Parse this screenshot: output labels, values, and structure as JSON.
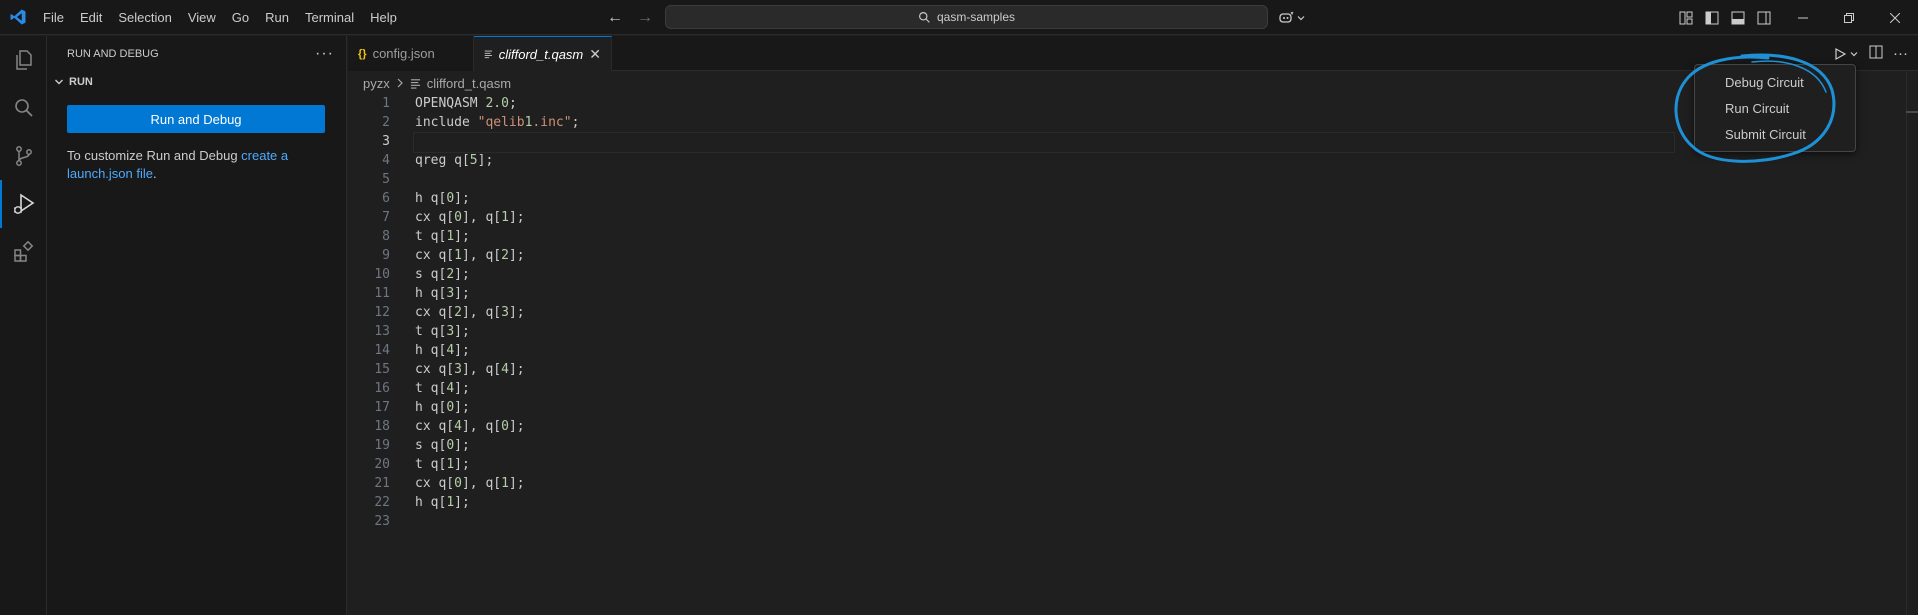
{
  "menu": [
    "File",
    "Edit",
    "Selection",
    "View",
    "Go",
    "Run",
    "Terminal",
    "Help"
  ],
  "search": {
    "text": "qasm-samples"
  },
  "activity": [
    "explorer-icon",
    "search-icon",
    "source-control-icon",
    "run-debug-icon",
    "extensions-icon"
  ],
  "sidebar": {
    "title": "RUN AND DEBUG",
    "section": "RUN",
    "run_button": "Run and Debug",
    "customize_prefix": "To customize Run and Debug ",
    "customize_link": "create a launch.json file",
    "customize_suffix": "."
  },
  "tabs": [
    {
      "label": "config.json",
      "icon": "json-icon"
    },
    {
      "label": "clifford_t.qasm",
      "icon": "file-lines-icon",
      "active": true
    }
  ],
  "breadcrumb": {
    "folder": "pyzx",
    "file": "clifford_t.qasm"
  },
  "code": {
    "current_line": 3,
    "lines": [
      "OPENQASM 2.0;",
      "include \"qelib1.inc\";",
      "",
      "qreg q[5];",
      "",
      "h q[0];",
      "cx q[0], q[1];",
      "t q[1];",
      "cx q[1], q[2];",
      "s q[2];",
      "h q[3];",
      "cx q[2], q[3];",
      "t q[3];",
      "h q[4];",
      "cx q[3], q[4];",
      "t q[4];",
      "h q[0];",
      "cx q[4], q[0];",
      "s q[0];",
      "t q[1];",
      "cx q[0], q[1];",
      "h q[1];",
      ""
    ]
  },
  "dropdown": [
    "Debug Circuit",
    "Run Circuit",
    "Submit Circuit"
  ],
  "colors": {
    "accent": "#0078d4",
    "string": "#ce9178",
    "number": "#b5cea8",
    "annotation": "#1e90d6"
  }
}
